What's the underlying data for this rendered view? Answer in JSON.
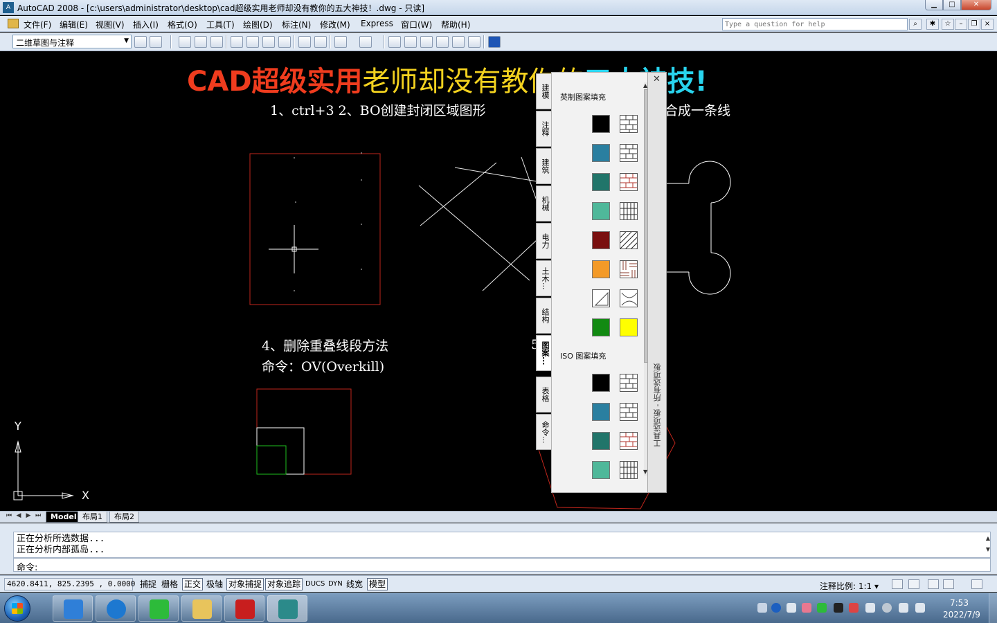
{
  "window": {
    "title": "AutoCAD 2008 - [c:\\users\\administrator\\desktop\\cad超级实用老师却没有教你的五大神技！.dwg - 只读]",
    "app_icon_text": "A",
    "minimize": "▁",
    "maximize": "□",
    "close": "✕"
  },
  "menu": {
    "items": [
      "文件(F)",
      "编辑(E)",
      "视图(V)",
      "插入(I)",
      "格式(O)",
      "工具(T)",
      "绘图(D)",
      "标注(N)",
      "修改(M)",
      "Express",
      "窗口(W)",
      "帮助(H)"
    ],
    "help_placeholder": "Type a question for help"
  },
  "toolbar": {
    "workspace": "二维草图与注释"
  },
  "drawing": {
    "headline_part1": "CAD超级实用",
    "headline_part2": "老师却没有教你的",
    "headline_part3": "五大神技!",
    "tips_line": "1、ctrl+3    2、BO创建封闭区域图形",
    "tip_right_fragment": "合成一条线",
    "tip4_title": "4、删除重叠线段方法",
    "tip4_command": "命令：OV(Overkill)",
    "tip5_fragment": "5",
    "ucs_y": "Y",
    "ucs_x": "X"
  },
  "palette": {
    "tabs": [
      "建模",
      "注释",
      "建筑",
      "机械",
      "电力",
      "土木...",
      "结构",
      "图案...",
      "表格",
      "命令..."
    ],
    "active_tab": "图案...",
    "section1": "英制图案填充",
    "section2": "ISO 图案填充",
    "side_label": "工具选项板 - 所有选项板",
    "close": "✕",
    "colors": {
      "black": "#000000",
      "blue": "#2a7fa0",
      "teal": "#21756a",
      "mint": "#4fb89a",
      "maroon": "#7a1010",
      "orange": "#f39a28",
      "green": "#128a12",
      "yellow": "#ffff00"
    }
  },
  "layout_tabs": [
    "Model",
    "布局1",
    "布局2"
  ],
  "command": {
    "history": [
      "正在分析所选数据...",
      "正在分析内部孤岛..."
    ],
    "prompt": "命令:"
  },
  "status": {
    "coords": "4620.8411,  825.2395 , 0.0000",
    "buttons": [
      "捕捉",
      "栅格",
      "正交",
      "极轴",
      "对象捕捉",
      "对象追踪",
      "DUCS",
      "DYN",
      "线宽",
      "模型"
    ],
    "active_buttons": [
      "正交",
      "对象捕捉",
      "对象追踪",
      "模型"
    ],
    "annotation_scale_label": "注释比例: 1:1 ▾"
  },
  "taskbar": {
    "time": "7:53",
    "date": "2022/7/9"
  }
}
